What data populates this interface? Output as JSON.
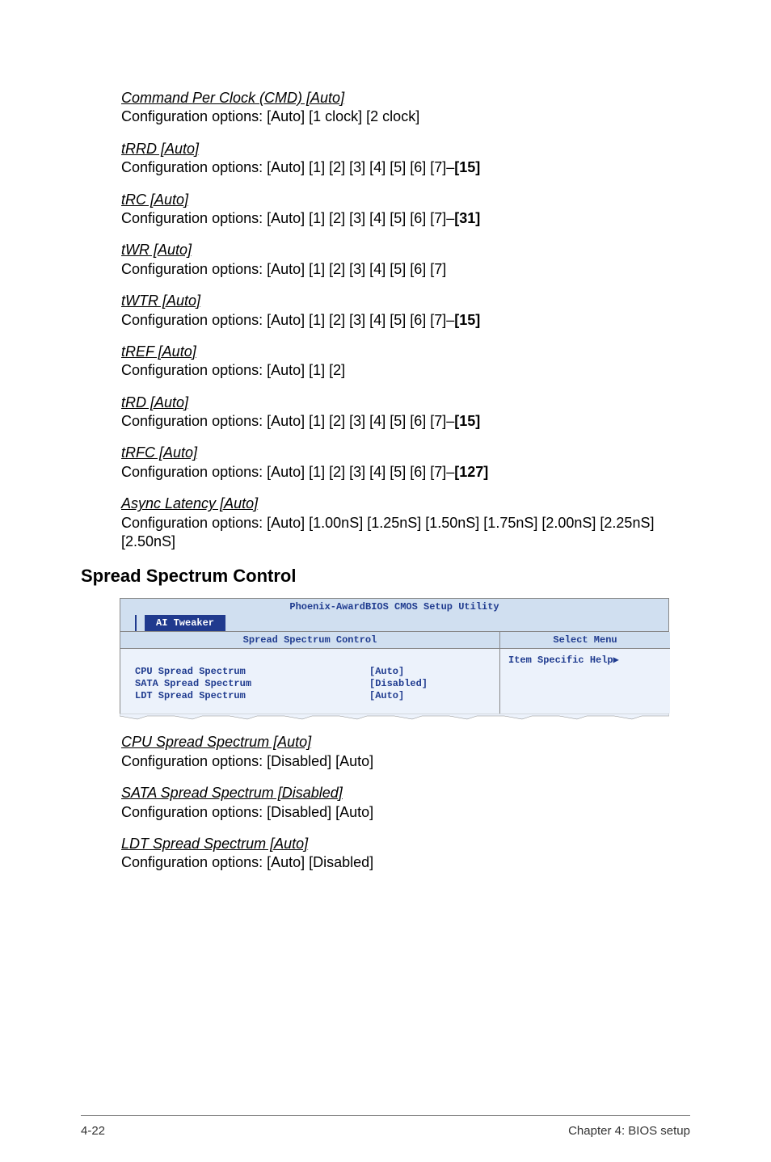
{
  "items_top": [
    {
      "title": "Command Per Clock (CMD) [Auto]",
      "desc": "Configuration options: [Auto] [1 clock] [2 clock]",
      "bold": ""
    },
    {
      "title": "tRRD [Auto]",
      "desc": "Configuration options: [Auto] [1] [2] [3] [4] [5] [6] [7]–",
      "bold": "[15]"
    },
    {
      "title": "tRC [Auto]",
      "desc": "Configuration options: [Auto] [1] [2] [3] [4] [5] [6] [7]–",
      "bold": "[31]"
    },
    {
      "title": "tWR [Auto]",
      "desc": "Configuration options: [Auto] [1] [2] [3] [4] [5] [6] [7]",
      "bold": ""
    },
    {
      "title": "tWTR [Auto]",
      "desc": "Configuration options: [Auto] [1] [2] [3] [4] [5] [6] [7]–",
      "bold": "[15]"
    },
    {
      "title": "tREF [Auto]",
      "desc": "Configuration options: [Auto] [1] [2]",
      "bold": ""
    },
    {
      "title": "tRD [Auto]",
      "desc": "Configuration options: [Auto] [1] [2] [3] [4] [5] [6] [7]–",
      "bold": "[15]"
    },
    {
      "title": "tRFC [Auto]",
      "desc": "Configuration options: [Auto] [1] [2] [3] [4] [5] [6] [7]–",
      "bold": "[127]"
    },
    {
      "title": "Async Latency [Auto]",
      "desc": "Configuration options: [Auto] [1.00nS] [1.25nS] [1.50nS] [1.75nS] [2.00nS] [2.25nS] [2.50nS]",
      "bold": ""
    }
  ],
  "section_heading": "Spread Spectrum Control",
  "bios": {
    "title": "Phoenix-AwardBIOS CMOS Setup Utility",
    "tab": "AI Tweaker",
    "header_left": "Spread Spectrum Control",
    "header_right": "Select Menu",
    "rows": [
      {
        "label": "CPU Spread Spectrum",
        "value": "[Auto]"
      },
      {
        "label": "SATA Spread Spectrum",
        "value": "[Disabled]"
      },
      {
        "label": "LDT Spread Spectrum",
        "value": "[Auto]"
      }
    ],
    "help": "Item Specific Help▶"
  },
  "items_bottom": [
    {
      "title": "CPU Spread Spectrum [Auto]",
      "desc": "Configuration options: [Disabled] [Auto]",
      "bold": ""
    },
    {
      "title": "SATA Spread Spectrum [Disabled]",
      "desc": "Configuration options: [Disabled] [Auto]",
      "bold": ""
    },
    {
      "title": "LDT Spread Spectrum [Auto]",
      "desc": "Configuration options: [Auto] [Disabled]",
      "bold": ""
    }
  ],
  "footer": {
    "left": "4-22",
    "right": "Chapter 4: BIOS setup"
  }
}
